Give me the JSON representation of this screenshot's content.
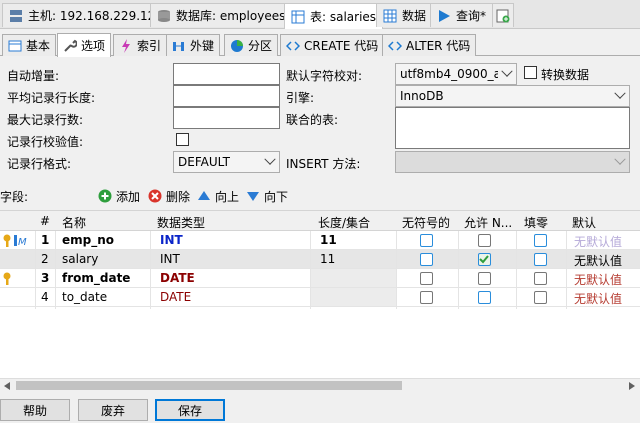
{
  "top_tabs": [
    {
      "label": "主机: 192.168.229.128",
      "icon": "server-icon"
    },
    {
      "label": "数据库: employees",
      "icon": "database-icon"
    },
    {
      "label": "表: salaries",
      "icon": "table-icon"
    },
    {
      "label": "数据",
      "icon": "grid-icon"
    },
    {
      "label": "查询*",
      "icon": "play-icon"
    }
  ],
  "sub_tabs": [
    {
      "label": "基本"
    },
    {
      "label": "选项"
    },
    {
      "label": "索引"
    },
    {
      "label": "外键"
    },
    {
      "label": "分区"
    },
    {
      "label": "CREATE 代码"
    },
    {
      "label": "ALTER 代码"
    }
  ],
  "options": {
    "auto_increment_label": "自动增量:",
    "avg_row_length_label": "平均记录行长度:",
    "max_rows_label": "最大记录行数:",
    "checksum_label": "记录行校验值:",
    "row_format_label": "记录行格式:",
    "row_format_value": "DEFAULT",
    "collation_label": "默认字符校对:",
    "collation_value": "utf8mb4_0900_ai_",
    "convert_label": "转换数据",
    "engine_label": "引擎:",
    "engine_value": "InnoDB",
    "union_label": "联合的表:",
    "insert_method_label": "INSERT 方法:"
  },
  "fields_toolbar": {
    "fields_label": "字段:",
    "add": "添加",
    "delete": "删除",
    "up": "向上",
    "down": "向下"
  },
  "columns": {
    "num": "#",
    "name": "名称",
    "type": "数据类型",
    "length": "长度/集合",
    "unsigned": "无符号的",
    "allow_null": "允许 N...",
    "zerofill": "填零",
    "default": "默认"
  },
  "rows": [
    {
      "num": "1",
      "name": "emp_no",
      "type": "INT",
      "length": "11",
      "default": "无默认值"
    },
    {
      "num": "2",
      "name": "salary",
      "type": "INT",
      "length": "11",
      "default": "无默认值"
    },
    {
      "num": "3",
      "name": "from_date",
      "type": "DATE",
      "length": "",
      "default": "无默认值"
    },
    {
      "num": "4",
      "name": "to_date",
      "type": "DATE",
      "length": "",
      "default": "无默认值"
    }
  ],
  "buttons": {
    "help": "帮助",
    "discard": "废弃",
    "save": "保存"
  },
  "colors": {
    "accent": "#0078d7",
    "type_int": "#0a24c9",
    "type_date": "#8b0000",
    "key": "#e6a817"
  }
}
